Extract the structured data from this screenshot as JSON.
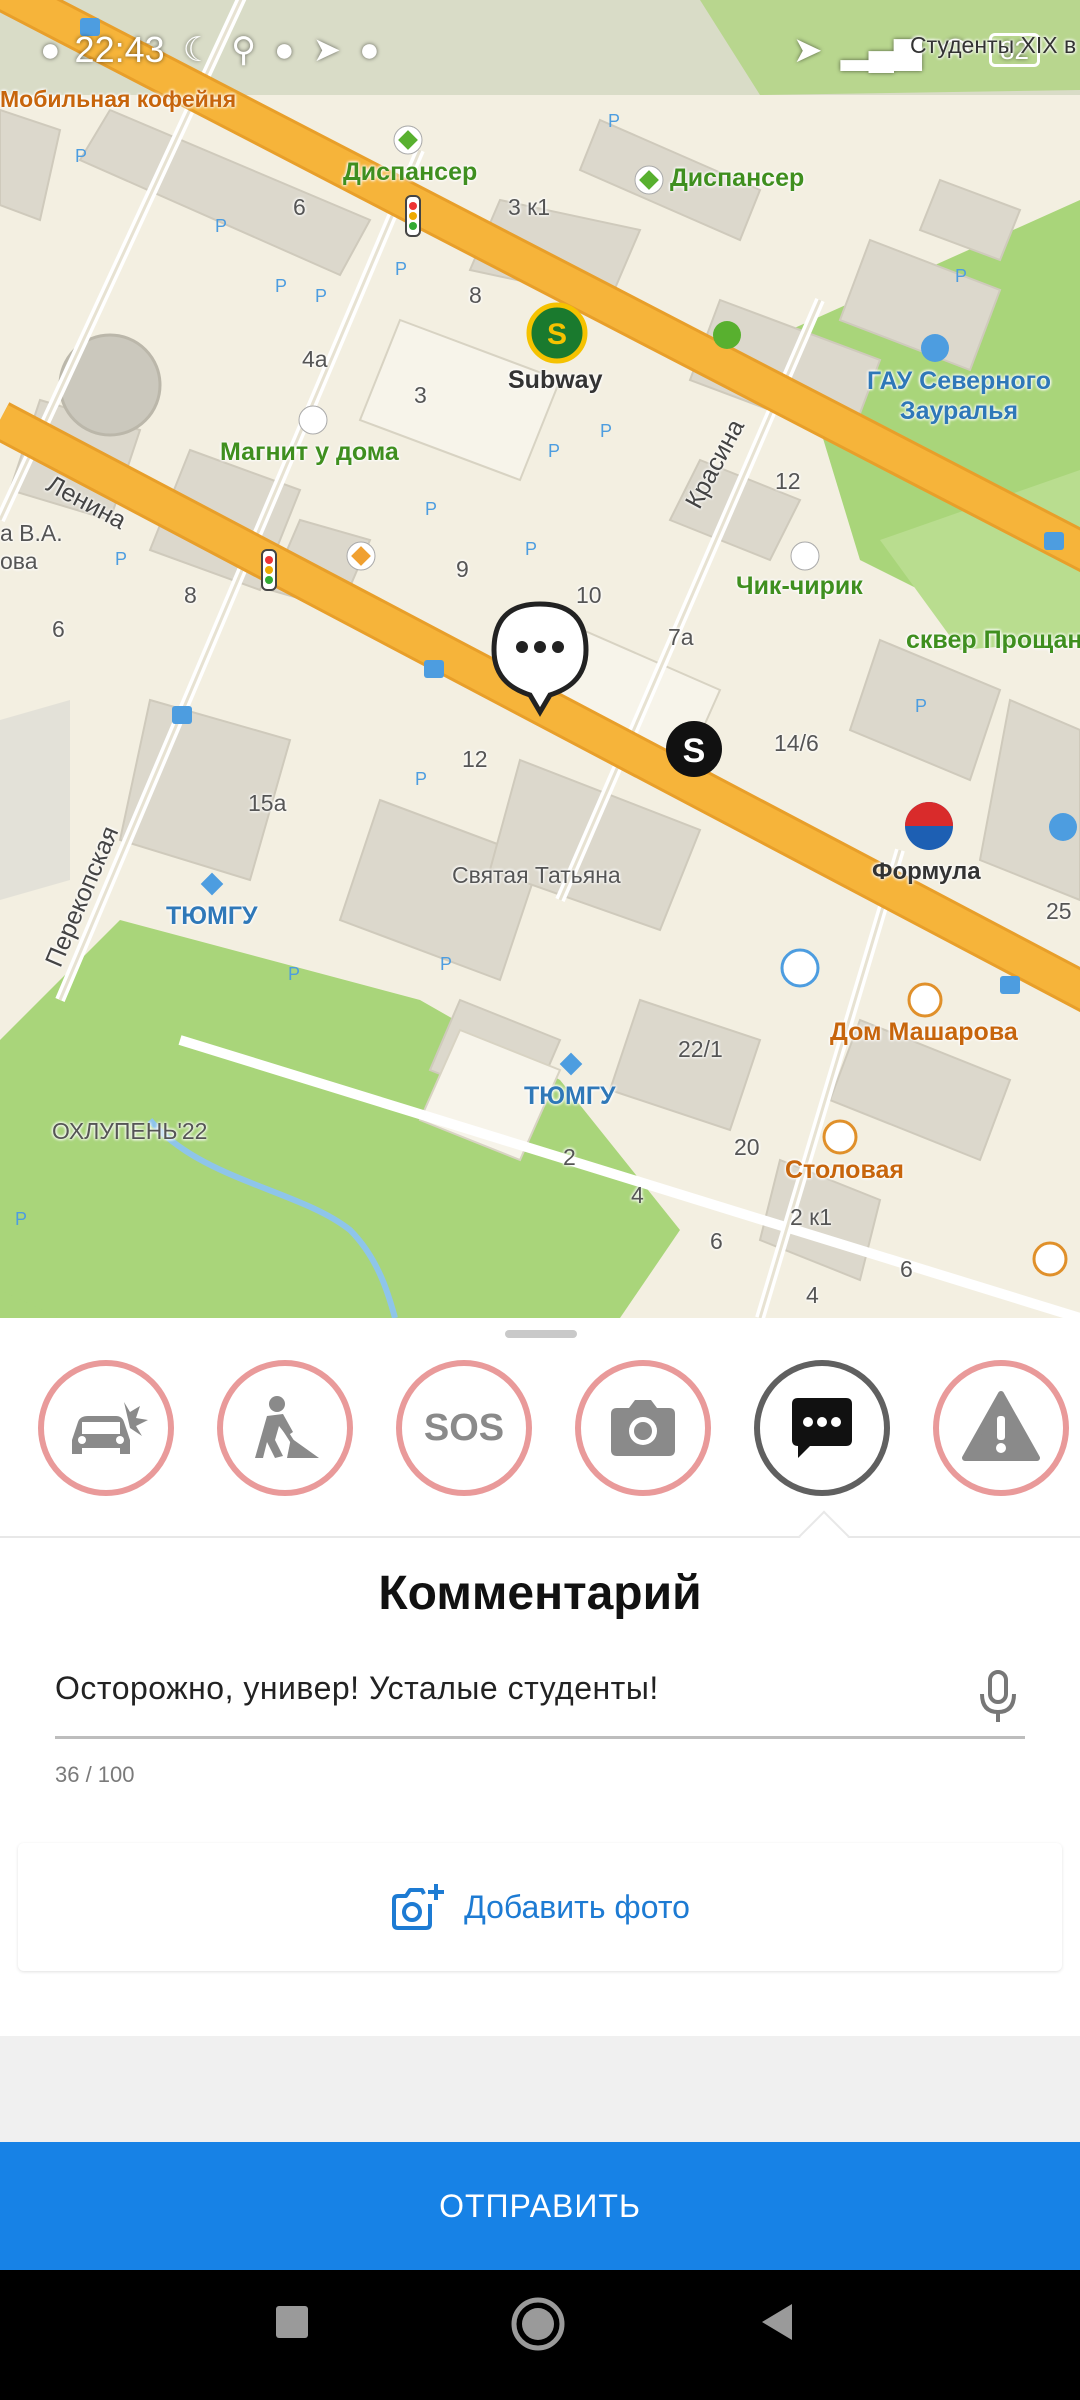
{
  "status_bar": {
    "time": "22:43",
    "battery": "82"
  },
  "map": {
    "labels": {
      "cafe": "Мобильная кофейня",
      "dispenser1": "Диспансер",
      "dispenser2": "Диспансер",
      "subway": "Subway",
      "magnit": "Магнит у дома",
      "gau": "ГАУ Северного Зауралья",
      "lenina": "Ленина",
      "krasina": "Красина",
      "chik": "Чик-чирик",
      "skver": "сквер Прощан",
      "formula": "Формула",
      "tyumgu1": "ТЮМГУ",
      "tyumgu2": "ТЮМГУ",
      "svyataya": "Святая Татьяна",
      "perekopskaya": "Перекопская",
      "okhlupen": "ОХЛУПЕНЬ'22",
      "dom_masharova": "Дом Машарова",
      "stolovaya": "Столовая",
      "studenty": "Студенты XIX в",
      "bva": "а В.А.",
      "ova": "ова"
    },
    "house_numbers": [
      "6",
      "3 к1",
      "8",
      "4а",
      "3",
      "9",
      "10",
      "7а",
      "12",
      "14/6",
      "8",
      "6",
      "12",
      "15а",
      "25",
      "22/1",
      "20",
      "2",
      "4",
      "6",
      "2 к1",
      "6",
      "4"
    ]
  },
  "sheet": {
    "categories": [
      {
        "name": "accident",
        "selected": false
      },
      {
        "name": "road-works",
        "selected": false
      },
      {
        "name": "sos",
        "label": "SOS",
        "selected": false
      },
      {
        "name": "camera",
        "selected": false
      },
      {
        "name": "comment",
        "selected": true
      },
      {
        "name": "warning",
        "selected": false
      }
    ],
    "title": "Комментарий",
    "comment_value": "Осторожно, универ! Усталые студенты!",
    "char_count": "36 / 100",
    "add_photo_label": "Добавить фото",
    "send_label": "ОТПРАВИТЬ"
  },
  "colors": {
    "accent": "#1782e6",
    "road": "#f6b43a",
    "park": "#a9d57a",
    "category_ring": "#e99a9a",
    "selected_ring": "#606060"
  }
}
